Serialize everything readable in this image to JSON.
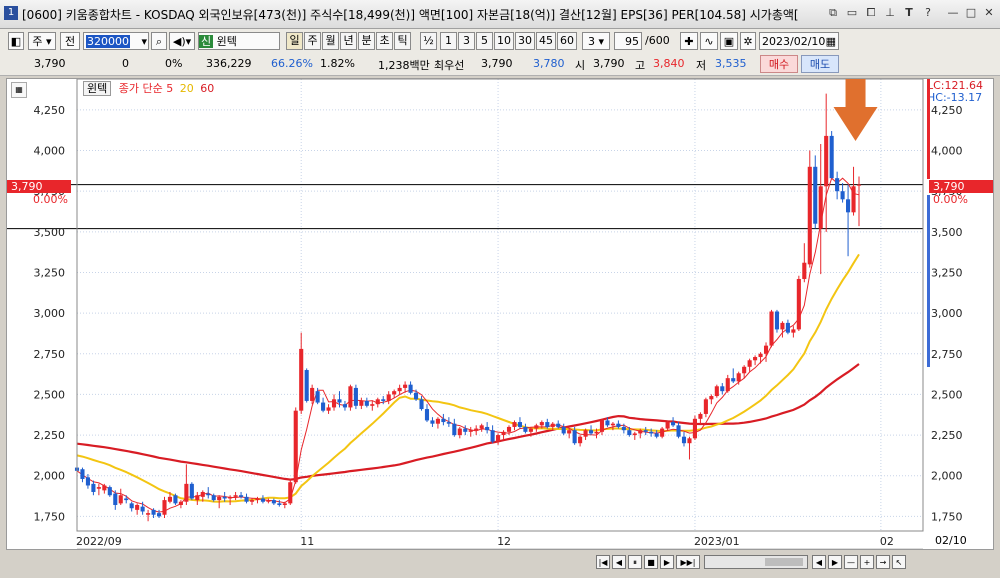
{
  "window": {
    "badge": "1",
    "title": "[0600] 키움종합차트 - KOSDAQ 외국인보유[473(천)] 주식수[18,499(천)] 액면[100] 자본금[18(억)] 결산[12월] EPS[36] PER[104.58] 시가총액["
  },
  "toolbar": {
    "period_weekly": "주",
    "scope": "전",
    "code": "320000",
    "market_badge": "신",
    "stock_name": "윈텍",
    "tabs": [
      "일",
      "주",
      "월",
      "년",
      "분",
      "초",
      "틱"
    ],
    "fraction": "½",
    "intervals": [
      "1",
      "3",
      "5",
      "10",
      "30",
      "45",
      "60"
    ],
    "interval_select": "3",
    "count": "95",
    "count_total": "/600",
    "date": "2023/02/10"
  },
  "infobar": {
    "price": "3,790",
    "change": "0",
    "change_pct": "0%",
    "volume": "336,229",
    "volume_pct": "66.26%",
    "rate": "1.82%",
    "amount": "1,238백만",
    "bid_label": "최우선",
    "bid1": "3,790",
    "bid2": "3,780",
    "open_label": "시",
    "open": "3,790",
    "high_label": "고",
    "high": "3,840",
    "low_label": "저",
    "low": "3,535",
    "buy_label": "매수",
    "sell_label": "매도"
  },
  "chart_legend": {
    "stock": "윈텍",
    "ma_label": "종가 단순",
    "ma5": "5",
    "ma20": "20",
    "ma60": "60"
  },
  "right_labels": {
    "lc": "LC:121.64",
    "hc": "HC:-13.17",
    "price_tag": "3,790",
    "pct_tag": "0.00%"
  },
  "colors": {
    "up": "#e8262b",
    "down": "#1f5fcf",
    "ma5": "#e8262b",
    "ma20": "#f3c512",
    "ma60": "#d81c24",
    "arrow": "#e0702e"
  },
  "chart_data": {
    "type": "candlestick",
    "y_ticks": [
      "4,250",
      "4,000",
      "3,750",
      "3,500",
      "3,250",
      "3,000",
      "2,750",
      "2,500",
      "2,250",
      "2,000",
      "1,750"
    ],
    "ylim": [
      1660,
      4440
    ],
    "x_labels": [
      {
        "label": "2022/09",
        "index": 0
      },
      {
        "label": "11",
        "index": 41
      },
      {
        "label": "12",
        "index": 77
      },
      {
        "label": "2023/01",
        "index": 113
      },
      {
        "label": "02",
        "index": 147
      }
    ],
    "right_date_label": "02/10",
    "horizontal_lines": [
      3790,
      3520
    ],
    "candles": [
      [
        2050,
        2060,
        2010,
        2030
      ],
      [
        2040,
        2050,
        1960,
        1980
      ],
      [
        1990,
        2010,
        1920,
        1940
      ],
      [
        1950,
        1970,
        1880,
        1900
      ],
      [
        1920,
        1950,
        1880,
        1930
      ],
      [
        1910,
        1950,
        1890,
        1940
      ],
      [
        1930,
        1940,
        1870,
        1880
      ],
      [
        1890,
        1910,
        1790,
        1820
      ],
      [
        1830,
        1920,
        1820,
        1880
      ],
      [
        1860,
        1880,
        1830,
        1850
      ],
      [
        1830,
        1840,
        1780,
        1800
      ],
      [
        1790,
        1830,
        1760,
        1820
      ],
      [
        1810,
        1840,
        1760,
        1780
      ],
      [
        1760,
        1790,
        1720,
        1770
      ],
      [
        1790,
        1800,
        1740,
        1760
      ],
      [
        1770,
        1790,
        1740,
        1750
      ],
      [
        1760,
        1870,
        1740,
        1850
      ],
      [
        1840,
        1900,
        1830,
        1870
      ],
      [
        1880,
        1890,
        1820,
        1830
      ],
      [
        1820,
        1850,
        1800,
        1840
      ],
      [
        1840,
        2070,
        1820,
        1950
      ],
      [
        1950,
        1960,
        1850,
        1860
      ],
      [
        1850,
        1900,
        1820,
        1880
      ],
      [
        1870,
        1910,
        1840,
        1900
      ],
      [
        1890,
        1930,
        1860,
        1880
      ],
      [
        1880,
        1890,
        1840,
        1850
      ],
      [
        1850,
        1880,
        1800,
        1870
      ],
      [
        1870,
        1900,
        1840,
        1860
      ],
      [
        1860,
        1880,
        1820,
        1870
      ],
      [
        1870,
        1900,
        1850,
        1880
      ],
      [
        1880,
        1900,
        1860,
        1870
      ],
      [
        1870,
        1890,
        1830,
        1840
      ],
      [
        1840,
        1860,
        1820,
        1850
      ],
      [
        1850,
        1870,
        1830,
        1860
      ],
      [
        1860,
        1880,
        1830,
        1840
      ],
      [
        1840,
        1860,
        1830,
        1850
      ],
      [
        1850,
        1860,
        1820,
        1830
      ],
      [
        1830,
        1850,
        1810,
        1820
      ],
      [
        1820,
        1840,
        1800,
        1830
      ],
      [
        1830,
        1980,
        1820,
        1960
      ],
      [
        1960,
        2420,
        1950,
        2400
      ],
      [
        2400,
        2880,
        2380,
        2780
      ],
      [
        2650,
        2660,
        2450,
        2460
      ],
      [
        2460,
        2560,
        2440,
        2540
      ],
      [
        2520,
        2540,
        2440,
        2450
      ],
      [
        2450,
        2480,
        2390,
        2400
      ],
      [
        2400,
        2440,
        2380,
        2420
      ],
      [
        2420,
        2500,
        2400,
        2470
      ],
      [
        2470,
        2520,
        2420,
        2450
      ],
      [
        2440,
        2460,
        2400,
        2420
      ],
      [
        2420,
        2560,
        2400,
        2550
      ],
      [
        2540,
        2560,
        2410,
        2430
      ],
      [
        2430,
        2480,
        2410,
        2460
      ],
      [
        2460,
        2480,
        2420,
        2430
      ],
      [
        2430,
        2460,
        2400,
        2440
      ],
      [
        2440,
        2480,
        2420,
        2470
      ],
      [
        2470,
        2490,
        2440,
        2460
      ],
      [
        2460,
        2520,
        2440,
        2500
      ],
      [
        2500,
        2530,
        2480,
        2520
      ],
      [
        2520,
        2560,
        2500,
        2540
      ],
      [
        2540,
        2580,
        2510,
        2560
      ],
      [
        2560,
        2580,
        2500,
        2510
      ],
      [
        2510,
        2530,
        2460,
        2470
      ],
      [
        2470,
        2490,
        2400,
        2410
      ],
      [
        2410,
        2440,
        2330,
        2340
      ],
      [
        2340,
        2360,
        2300,
        2320
      ],
      [
        2320,
        2360,
        2290,
        2350
      ],
      [
        2350,
        2380,
        2310,
        2330
      ],
      [
        2330,
        2360,
        2300,
        2320
      ],
      [
        2320,
        2350,
        2240,
        2250
      ],
      [
        2250,
        2300,
        2230,
        2290
      ],
      [
        2290,
        2310,
        2250,
        2270
      ],
      [
        2270,
        2300,
        2240,
        2280
      ],
      [
        2280,
        2310,
        2250,
        2290
      ],
      [
        2290,
        2320,
        2270,
        2310
      ],
      [
        2300,
        2330,
        2260,
        2280
      ],
      [
        2280,
        2310,
        2200,
        2210
      ],
      [
        2210,
        2260,
        2190,
        2250
      ],
      [
        2250,
        2280,
        2220,
        2270
      ],
      [
        2270,
        2310,
        2250,
        2300
      ],
      [
        2300,
        2340,
        2280,
        2330
      ],
      [
        2330,
        2360,
        2290,
        2300
      ],
      [
        2300,
        2320,
        2260,
        2270
      ],
      [
        2270,
        2300,
        2240,
        2290
      ],
      [
        2290,
        2320,
        2270,
        2310
      ],
      [
        2310,
        2340,
        2290,
        2330
      ],
      [
        2330,
        2350,
        2290,
        2300
      ],
      [
        2300,
        2330,
        2280,
        2320
      ],
      [
        2320,
        2340,
        2290,
        2300
      ],
      [
        2300,
        2320,
        2250,
        2260
      ],
      [
        2260,
        2290,
        2230,
        2280
      ],
      [
        2280,
        2300,
        2190,
        2200
      ],
      [
        2200,
        2250,
        2180,
        2240
      ],
      [
        2240,
        2290,
        2220,
        2280
      ],
      [
        2280,
        2310,
        2250,
        2260
      ],
      [
        2260,
        2290,
        2230,
        2270
      ],
      [
        2270,
        2350,
        2250,
        2340
      ],
      [
        2340,
        2360,
        2300,
        2310
      ],
      [
        2310,
        2330,
        2280,
        2320
      ],
      [
        2320,
        2340,
        2290,
        2300
      ],
      [
        2300,
        2320,
        2260,
        2280
      ],
      [
        2280,
        2300,
        2240,
        2250
      ],
      [
        2250,
        2270,
        2220,
        2260
      ],
      [
        2260,
        2290,
        2230,
        2280
      ],
      [
        2280,
        2300,
        2250,
        2270
      ],
      [
        2270,
        2290,
        2240,
        2260
      ],
      [
        2260,
        2280,
        2230,
        2240
      ],
      [
        2240,
        2300,
        2230,
        2290
      ],
      [
        2290,
        2340,
        2280,
        2330
      ],
      [
        2330,
        2360,
        2300,
        2310
      ],
      [
        2310,
        2330,
        2230,
        2240
      ],
      [
        2240,
        2270,
        2180,
        2200
      ],
      [
        2200,
        2240,
        2100,
        2230
      ],
      [
        2230,
        2370,
        2220,
        2350
      ],
      [
        2350,
        2390,
        2320,
        2380
      ],
      [
        2380,
        2480,
        2360,
        2470
      ],
      [
        2470,
        2500,
        2440,
        2490
      ],
      [
        2490,
        2560,
        2480,
        2550
      ],
      [
        2550,
        2570,
        2500,
        2520
      ],
      [
        2520,
        2620,
        2510,
        2600
      ],
      [
        2600,
        2660,
        2570,
        2580
      ],
      [
        2580,
        2640,
        2560,
        2630
      ],
      [
        2630,
        2680,
        2600,
        2670
      ],
      [
        2670,
        2720,
        2640,
        2710
      ],
      [
        2710,
        2740,
        2680,
        2730
      ],
      [
        2730,
        2760,
        2690,
        2750
      ],
      [
        2750,
        2820,
        2700,
        2800
      ],
      [
        2800,
        3020,
        2790,
        3010
      ],
      [
        3010,
        3020,
        2880,
        2900
      ],
      [
        2900,
        2950,
        2850,
        2940
      ],
      [
        2940,
        2960,
        2870,
        2880
      ],
      [
        2880,
        2920,
        2850,
        2900
      ],
      [
        2900,
        3230,
        2890,
        3210
      ],
      [
        3210,
        3430,
        3190,
        3310
      ],
      [
        3300,
        4000,
        3280,
        3900
      ],
      [
        3900,
        3970,
        3520,
        3550
      ],
      [
        3520,
        4040,
        3240,
        3780
      ],
      [
        3780,
        4350,
        3500,
        4090
      ],
      [
        4090,
        4120,
        3890,
        3830
      ],
      [
        3830,
        3870,
        3700,
        3750
      ],
      [
        3750,
        3800,
        3680,
        3700
      ],
      [
        3700,
        3790,
        3350,
        3620
      ],
      [
        3620,
        3900,
        3600,
        3780
      ],
      [
        3790,
        3840,
        3535,
        3790
      ]
    ]
  }
}
